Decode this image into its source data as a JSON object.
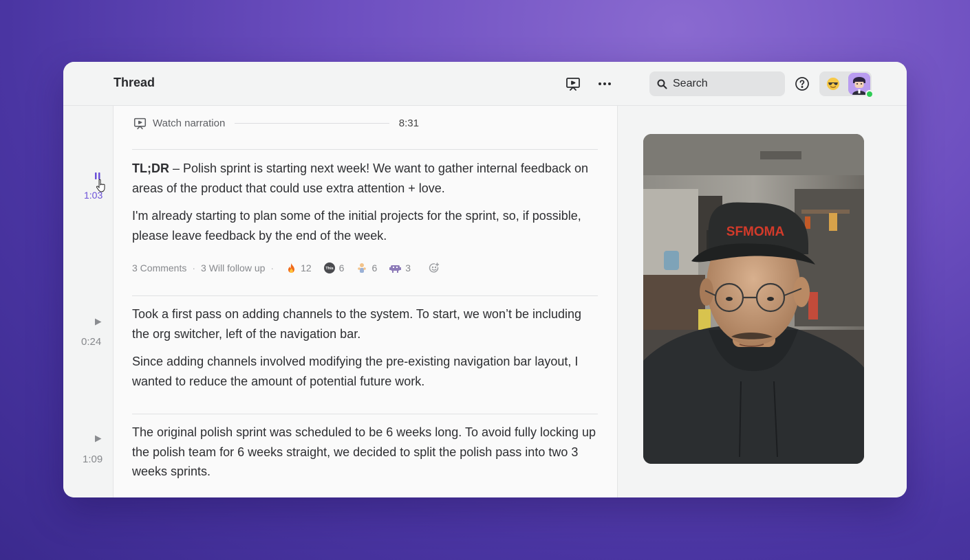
{
  "header": {
    "title": "Thread",
    "search_placeholder": "Search"
  },
  "narration": {
    "label": "Watch narration",
    "duration": "8:31"
  },
  "messages": [
    {
      "timestamp": "1:03",
      "state": "playing",
      "lead": "TL;DR",
      "dash": " – ",
      "p1": "Polish sprint is starting next week! We want to gather internal feedback on areas of the product that could use extra attention + love.",
      "p2": "I'm already starting to plan some of the initial projects for the sprint, so, if possible, please leave feedback by the end of the week.",
      "comments": "3 Comments",
      "follow_up": "3 Will follow up",
      "reactions": [
        {
          "icon": "fire-icon",
          "count": "12"
        },
        {
          "icon": "this-badge-icon",
          "count": "6"
        },
        {
          "icon": "clapping-person-icon",
          "count": "6"
        },
        {
          "icon": "pixel-critter-icon",
          "count": "3"
        }
      ]
    },
    {
      "timestamp": "0:24",
      "state": "paused",
      "p1": "Took a first pass on adding channels to the system. To start, we won’t be including the org switcher, left of the navigation bar.",
      "p2": "Since adding channels involved modifying the pre-existing navigation bar layout, I wanted to reduce the amount of potential future work."
    },
    {
      "timestamp": "1:09",
      "state": "paused",
      "p1": "The original polish sprint was scheduled to be 6 weeks long. To avoid fully locking up the polish team for 6 weeks straight, we decided to split the polish pass into two 3 weeks sprints."
    }
  ],
  "badge_text": "This",
  "video_cap_text": "SFMOMA",
  "colors": {
    "accent": "#6a4fd8",
    "online": "#2ecc55",
    "background_purple": "#6d4fc0"
  }
}
